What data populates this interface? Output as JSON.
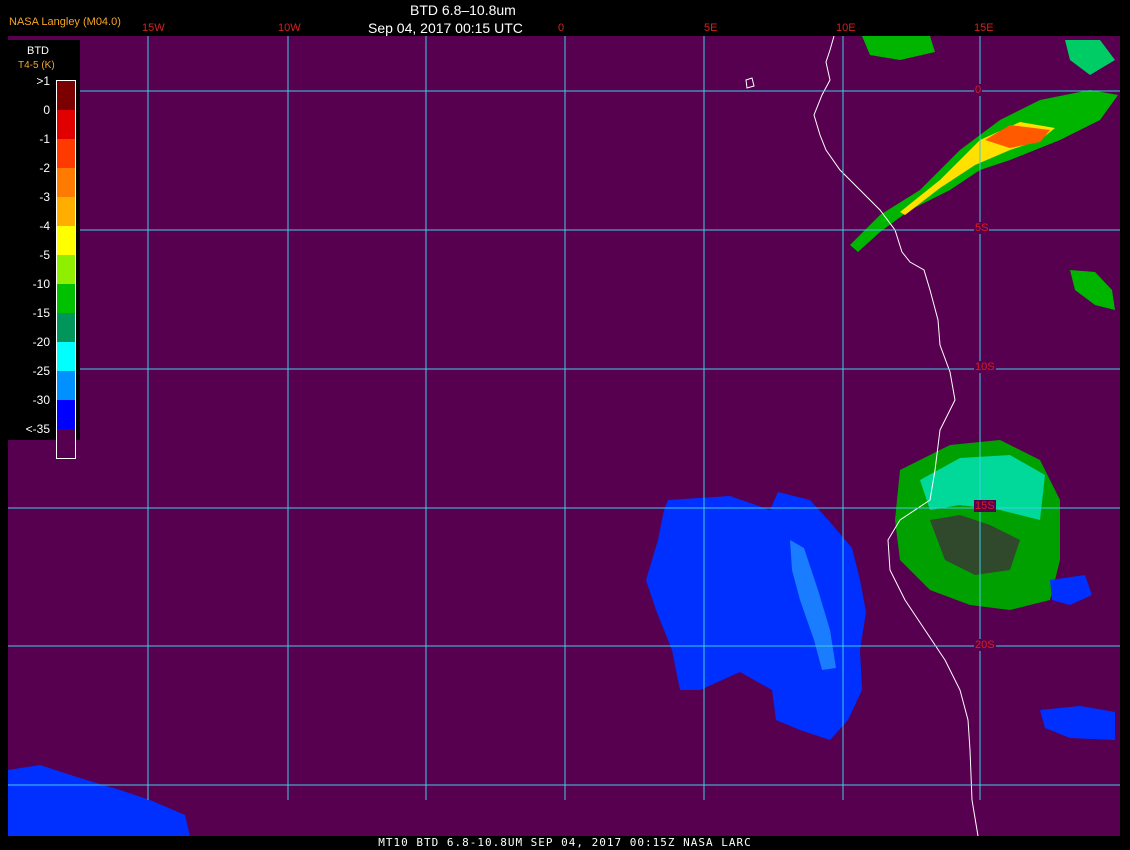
{
  "header": {
    "title": "BTD 6.8–10.8um",
    "datetime": "Sep 04, 2017 00:15 UTC",
    "credit": "NASA Langley (M04.0)"
  },
  "legend": {
    "title": "BTD",
    "subtitle": "T4-5 (K)",
    "labels": [
      ">1",
      "0",
      "-1",
      "-2",
      "-3",
      "-4",
      "-5",
      "-10",
      "-15",
      "-20",
      "-25",
      "-30",
      "<-35"
    ],
    "colors": [
      "#7b0000",
      "#e00000",
      "#ff3a00",
      "#ff7a00",
      "#ffae00",
      "#ffff00",
      "#90ee00",
      "#00c000",
      "#00955a",
      "#00ffff",
      "#0090ff",
      "#0000ff",
      "#57004f"
    ]
  },
  "lon_labels": [
    "15W",
    "10W",
    "0",
    "5E",
    "10E",
    "15E"
  ],
  "lat_labels": [
    "0",
    "5S",
    "10S",
    "15S",
    "20S"
  ],
  "footer": "MT10  BTD 6.8-10.8UM  SEP 04, 2017 00:15Z  NASA LARC",
  "colors": {
    "background": "#57004f",
    "grid": "#3ecde6",
    "label_red": "#d42020",
    "coast": "#ffffff"
  }
}
